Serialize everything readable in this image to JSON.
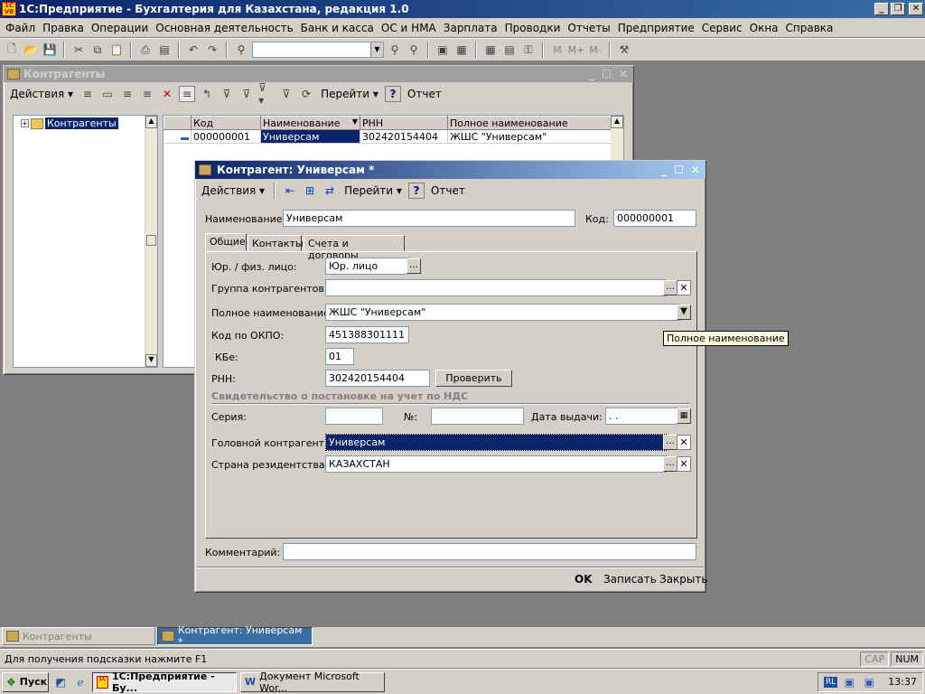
{
  "app": {
    "title": "1С:Предприятие - Бухгалтерия для Казахстана, редакция 1.0",
    "icon_text": "1C V8"
  },
  "menu": [
    "Файл",
    "Правка",
    "Операции",
    "Основная деятельность",
    "Банк и касса",
    "ОС и НМА",
    "Зарплата",
    "Проводки",
    "Отчеты",
    "Предприятие",
    "Сервис",
    "Окна",
    "Справка"
  ],
  "toolbar": {
    "search_value": "",
    "m_buttons": [
      "M",
      "M+",
      "M-"
    ]
  },
  "list_window": {
    "title": "Контрагенты",
    "actions_label": "Действия",
    "goto_label": "Перейти",
    "report_label": "Отчет",
    "help_label": "?",
    "tree_root": "Контрагенты",
    "columns": [
      "Код",
      "Наименование",
      "РНН",
      "Полное наименование"
    ],
    "rows": [
      {
        "code": "000000001",
        "name": "Универсам",
        "rnn": "302420154404",
        "full_name": "ЖШС \"Универсам\""
      }
    ]
  },
  "form": {
    "title": "Контрагент: Универсам *",
    "actions_label": "Действия",
    "goto_label": "Перейти",
    "report_label": "Отчет",
    "help_label": "?",
    "name_label": "Наименование:",
    "name_value": "Универсам",
    "code_label": "Код:",
    "code_value": "000000001",
    "tabs": [
      "Общие",
      "Контакты",
      "Счета и договоры"
    ],
    "legal_label": "Юр. / физ. лицо:",
    "legal_value": "Юр. лицо",
    "group_label": "Группа контрагентов:",
    "group_value": "",
    "fullname_label": "Полное наименование:",
    "fullname_value": "ЖШС \"Универсам\"",
    "okpo_label": "Код по ОКПО:",
    "okpo_value": "451388301111",
    "kbe_label": "КБе:",
    "kbe_value": "01",
    "rnn_label": "РНН:",
    "rnn_value": "302420154404",
    "check_button": "Проверить",
    "vat_section": "Свидетельство о постановке на учет по НДС",
    "series_label": "Серия:",
    "series_value": "",
    "number_label": "№:",
    "number_value": "",
    "date_label": "Дата выдачи:",
    "date_value": " .  .",
    "head_label": "Головной контрагент:",
    "head_value": "Универсам",
    "country_label": "Страна резидентства:",
    "country_value": "КАЗАХСТАН",
    "comment_label": "Комментарий:",
    "comment_value": "",
    "ok_label": "OK",
    "save_label": "Записать",
    "close_label": "Закрыть",
    "tooltip": "Полное наименование"
  },
  "mdi_tabs": [
    "Контрагенты",
    "Контрагент: Универсам *"
  ],
  "statusbar": {
    "hint": "Для получения подсказки нажмите F1",
    "cap": "CAP",
    "num": "NUM"
  },
  "taskbar": {
    "start_label": "Пуск",
    "tasks": [
      "1С:Предприятие - Бу...",
      "Документ Microsoft Wor..."
    ],
    "lang": "RL",
    "clock": "13:37"
  },
  "colors": {
    "selection": "#0a246a",
    "titlebar": "#0a246a",
    "face": "#d4d0c8"
  }
}
